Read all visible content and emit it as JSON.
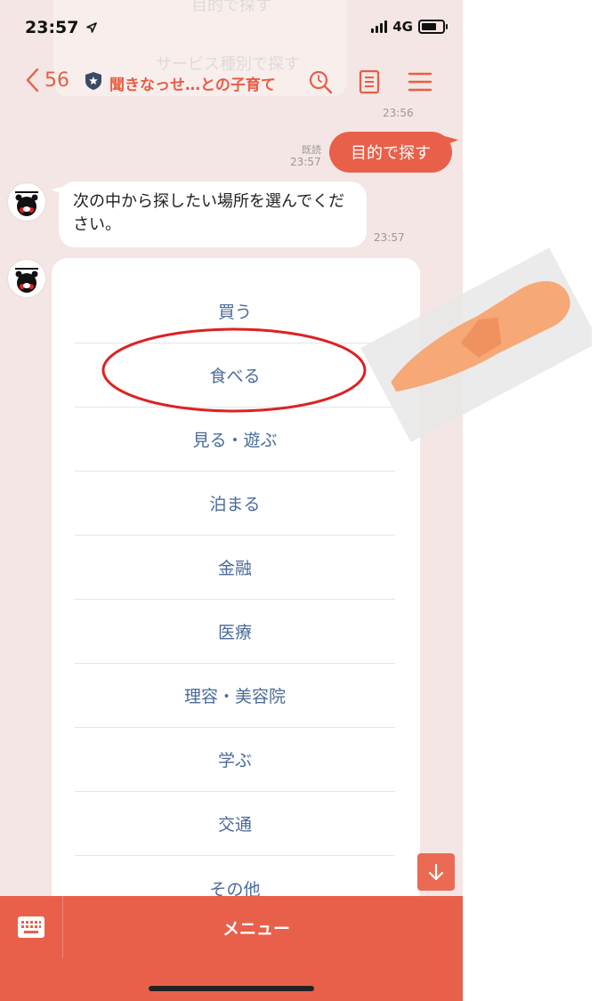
{
  "status": {
    "time": "23:57",
    "network": "4G"
  },
  "ghost": {
    "line1": "目的で探す",
    "line2": "サービス種別で探す"
  },
  "header": {
    "back_count": "56",
    "title": "聞きなっせ…との子育て"
  },
  "messages": {
    "out_time": "23:56",
    "out_read": "既読",
    "out_read_time": "23:57",
    "out_text": "目的で探す",
    "in_text": "次の中から探したい場所を選んでください。",
    "in_time": "23:57"
  },
  "options": [
    "買う",
    "食べる",
    "見る・遊ぶ",
    "泊まる",
    "金融",
    "医療",
    "理容・美容院",
    "学ぶ",
    "交通",
    "その他"
  ],
  "bottom": {
    "menu_label": "メニュー"
  },
  "colors": {
    "accent": "#e9604a",
    "background": "#f4e6e4",
    "option_text": "#4a6b9a"
  },
  "icons": [
    "back-chevron-icon",
    "shield-icon",
    "search-icon",
    "notes-icon",
    "menu-icon",
    "arrow-down-icon",
    "keyboard-icon",
    "pointing-hand-icon"
  ]
}
